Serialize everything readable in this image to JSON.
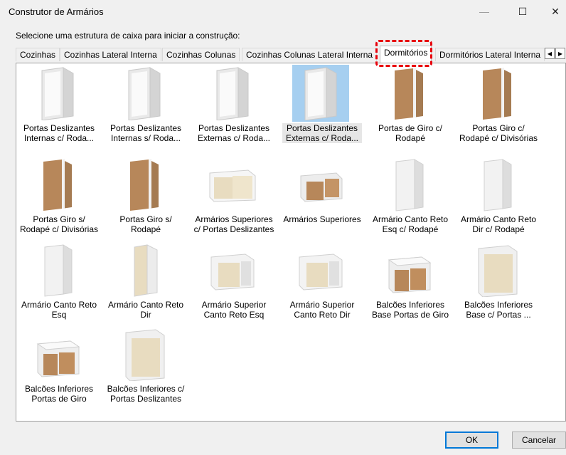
{
  "window": {
    "title": "Construtor de Armários",
    "minimize": "—",
    "maximize": "☐",
    "close": "✕"
  },
  "prompt": "Selecione uma estrutura de caixa para iniciar a construção:",
  "tabs": [
    {
      "label": "Cozinhas"
    },
    {
      "label": "Cozinhas Lateral Interna"
    },
    {
      "label": "Cozinhas Colunas"
    },
    {
      "label": "Cozinhas Colunas Lateral Interna"
    },
    {
      "label": "Dormitórios"
    },
    {
      "label": "Dormitórios Lateral Interna"
    }
  ],
  "active_tab": "Dormitórios",
  "scroll": {
    "left": "◀",
    "right": "▶"
  },
  "items": [
    {
      "label": "Portas Deslizantes\nInternas c/ Roda...",
      "thumb": "tall-empty"
    },
    {
      "label": "Portas Deslizantes\nInternas s/ Roda...",
      "thumb": "tall-empty"
    },
    {
      "label": "Portas Deslizantes\nExternas c/ Roda...",
      "thumb": "tall-empty"
    },
    {
      "label": "Portas Deslizantes\nExternas c/ Roda...",
      "thumb": "tall-empty",
      "selected": true
    },
    {
      "label": "Portas de Giro c/\nRodapé",
      "thumb": "tall-wood"
    },
    {
      "label": "Portas Giro c/\nRodapé c/ Divisórias",
      "thumb": "tall-wood"
    },
    {
      "label": "Portas Giro s/\nRodapé c/ Divisórias",
      "thumb": "tall-wood"
    },
    {
      "label": "Portas Giro s/\nRodapé",
      "thumb": "tall-wood"
    },
    {
      "label": "Armários Superiores\nc/ Portas Deslizantes",
      "thumb": "upper-beige"
    },
    {
      "label": "Armários Superiores",
      "thumb": "upper-wood"
    },
    {
      "label": "Armário Canto Reto\nEsq c/ Rodapé",
      "thumb": "corner-white"
    },
    {
      "label": "Armário Canto Reto\nDir c/ Rodapé",
      "thumb": "corner-white"
    },
    {
      "label": "Armário Canto Reto\nEsq",
      "thumb": "corner-white"
    },
    {
      "label": "Armário Canto Reto\nDir",
      "thumb": "corner-beige"
    },
    {
      "label": "Armário Superior\nCanto Reto Esq",
      "thumb": "upper-corner"
    },
    {
      "label": "Armário Superior\nCanto Reto Dir",
      "thumb": "upper-corner"
    },
    {
      "label": "Balcões Inferiores\nBase Portas de Giro",
      "thumb": "base-wood"
    },
    {
      "label": "Balcões Inferiores\nBase c/ Portas ...",
      "thumb": "base-beige"
    },
    {
      "label": "Balcões Inferiores\nPortas de Giro",
      "thumb": "base-wood"
    },
    {
      "label": "Balcões Inferiores c/\nPortas Deslizantes",
      "thumb": "base-beige"
    }
  ],
  "buttons": {
    "ok": "OK",
    "cancel": "Cancelar"
  },
  "colors": {
    "highlight": "#e8000b",
    "selection": "#a6cff0",
    "wood": "#b7875a",
    "beige": "#e8dcc0"
  }
}
